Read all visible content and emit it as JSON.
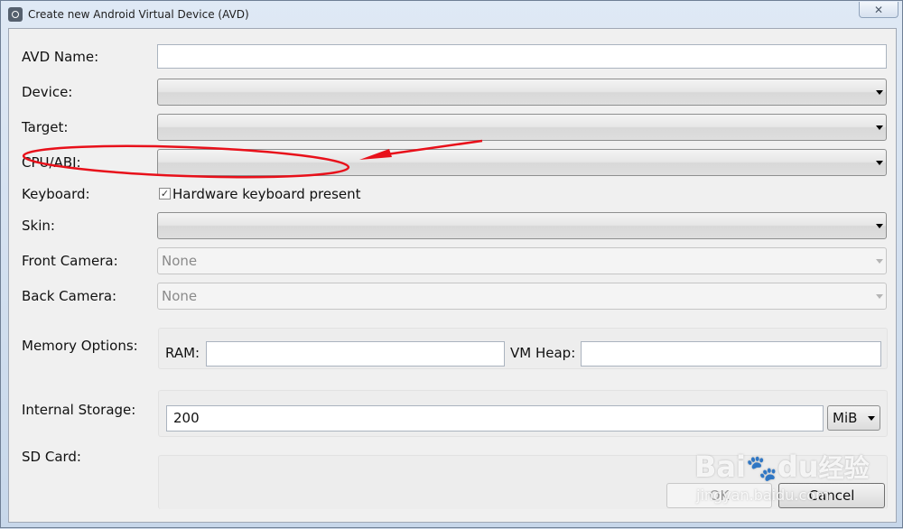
{
  "window": {
    "title": "Create new Android Virtual Device (AVD)",
    "close_glyph": "✕"
  },
  "fields": {
    "avd_name": {
      "label": "AVD Name:",
      "value": ""
    },
    "device": {
      "label": "Device:",
      "value": ""
    },
    "target": {
      "label": "Target:",
      "value": ""
    },
    "cpu_abi": {
      "label": "CPU/ABI:",
      "value": ""
    },
    "keyboard": {
      "label": "Keyboard:",
      "checkbox_label": "Hardware keyboard present",
      "checked": true,
      "check_glyph": "✓"
    },
    "skin": {
      "label": "Skin:",
      "value": ""
    },
    "front_camera": {
      "label": "Front Camera:",
      "value": "None"
    },
    "back_camera": {
      "label": "Back Camera:",
      "value": "None"
    },
    "memory": {
      "label": "Memory Options:",
      "ram_label": "RAM:",
      "ram_value": "",
      "vm_heap_label": "VM Heap:",
      "vm_heap_value": ""
    },
    "internal_storage": {
      "label": "Internal Storage:",
      "value": "200",
      "unit": "MiB"
    },
    "sd_card": {
      "label": "SD Card:"
    }
  },
  "buttons": {
    "ok": "OK",
    "cancel": "Cancel"
  },
  "annotation": {
    "color": "#e8101a"
  },
  "watermark": {
    "logo_text": "Bai",
    "logo_text_2": "du",
    "cn_text": "经验",
    "url": "jingyan.baidu.com"
  }
}
